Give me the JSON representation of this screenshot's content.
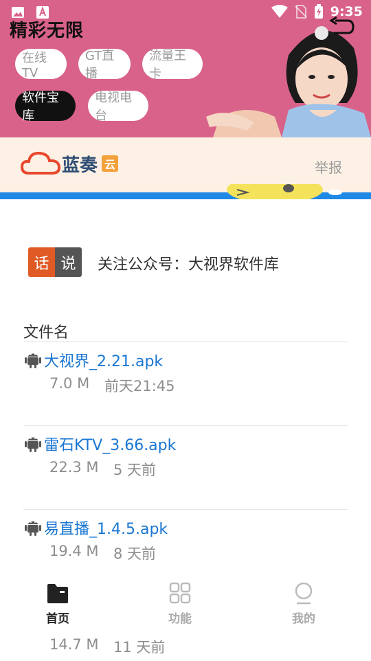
{
  "status_bar": {
    "time": "9:35"
  },
  "header": {
    "title": "精彩无限",
    "pills": [
      "在线TV",
      "GT直播",
      "流量王卡",
      "软件宝库",
      "电视电台"
    ],
    "active_pill": "软件宝库"
  },
  "cloud": {
    "name": "蓝奏",
    "tag": "云",
    "report": "举报"
  },
  "talk": {
    "badge_left": "话",
    "badge_right": "说",
    "text": "关注公众号：大视界软件库"
  },
  "files": {
    "header": "文件名",
    "items": [
      {
        "name": "大视界_2.21.apk",
        "size": "7.0 M",
        "time": "前天21:45"
      },
      {
        "name": "雷石KTV_3.66.apk",
        "size": "22.3 M",
        "time": "5 天前"
      },
      {
        "name": "易直播_1.4.5.apk",
        "size": "19.4 M",
        "time": "8 天前"
      },
      {
        "name": "",
        "size": "14.7 M",
        "time": "11 天前"
      }
    ]
  },
  "nav": {
    "home": "首页",
    "features": "功能",
    "mine": "我的"
  },
  "colors": {
    "header_bg": "#d9628a",
    "link": "#1976d2",
    "accent_orange": "#e05a26"
  }
}
